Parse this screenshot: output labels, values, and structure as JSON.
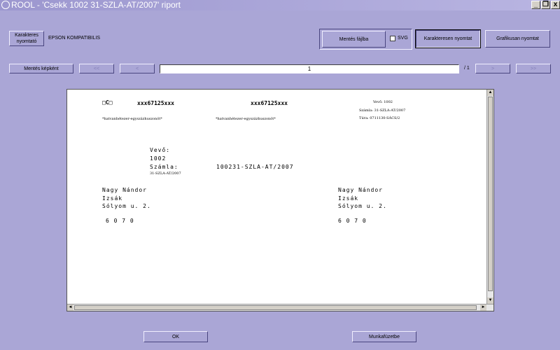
{
  "window": {
    "title": "ROOL  -  'Csekk 1002 31-SZLA-AT/2007' riport",
    "minimize": "_",
    "restore": "❐",
    "close": "x"
  },
  "toolbar": {
    "karakteres_nyomtato_label": "Karakteres nyomtató",
    "printer_name": "EPSON KOMPATIBILIS",
    "mentes_fajlba_label": "Mentés fájlba",
    "svg_label": "SVG",
    "karakteresen_nyomtat_label": "Karakteresen nyomtat",
    "grafikusan_nyomtat_label": "Grafikusan nyomtat"
  },
  "navbar": {
    "mentes_kepkent_label": "Mentés képként",
    "first_label": "<<",
    "prev_label": "<",
    "page_value": "1",
    "page_total": "/ 1",
    "next_label": ">",
    "last_label": ">>"
  },
  "document": {
    "code_box": "□C□",
    "code1": "xxx67125xxx",
    "code2": "xxx67125xxx",
    "words1": "*hatvanhétezer-egyszázhuszonöt*",
    "words2": "*hatvanhétezer-egyszázhuszonöt*",
    "vevo_small": "Vevő: 1002",
    "szamla_small": "Számla: 31-SZLA-AT/2007",
    "tura_small": "Túra: 0711130-SÁCS/2",
    "vevo_label": "Vevő:",
    "vevo_value": "1002",
    "szamla_label": "Számla:",
    "szamla_small2": "31-SZLA-AT/2007",
    "szamla_value": "100231-SZLA-AT/2007",
    "name_left": "Nagy Nándor",
    "city_left": "Izsák",
    "street_left": "Sólyom u. 2.",
    "zip_left": "6 0 7 0",
    "name_right": "Nagy Nándor",
    "city_right": "Izsák",
    "street_right": "Sólyom u. 2.",
    "zip_right": "6 0 7 0"
  },
  "scrollbar": {
    "up": "▲",
    "down": "▼",
    "left": "◄",
    "right": "►"
  },
  "footer": {
    "ok_label": "OK",
    "munkafuzetbe_label": "Munkafüzetbe"
  }
}
